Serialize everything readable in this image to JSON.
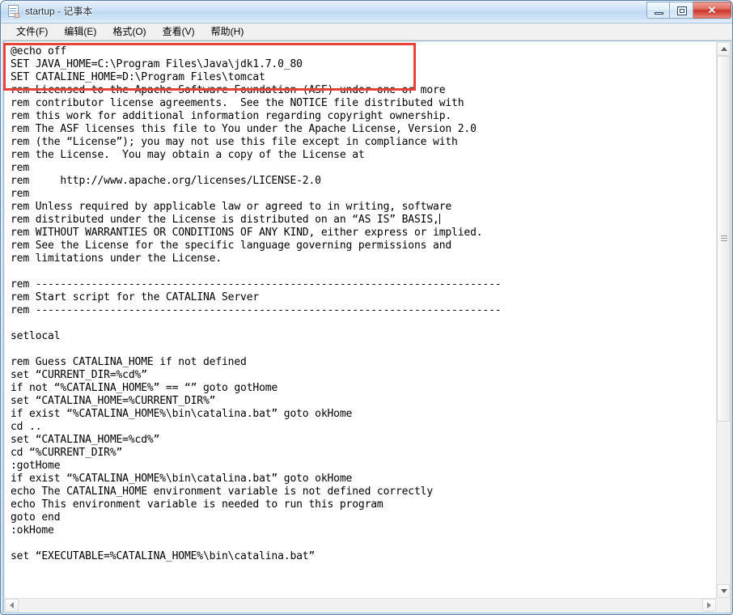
{
  "window": {
    "title": "startup - 记事本",
    "icon": "notepad-icon",
    "caption_buttons": [
      {
        "name": "minimize",
        "glyph": "—"
      },
      {
        "name": "maximize",
        "glyph": "□"
      },
      {
        "name": "close",
        "glyph": "✕"
      }
    ]
  },
  "menubar": {
    "items": [
      {
        "label": "文件(F)"
      },
      {
        "label": "编辑(E)"
      },
      {
        "label": "格式(O)"
      },
      {
        "label": "查看(V)"
      },
      {
        "label": "帮助(H)"
      }
    ]
  },
  "editor": {
    "highlighted_lines": "@echo off\nSET JAVA_HOME=C:\\Program Files\\Java\\jdk1.7.0_80\nSET CATALINE_HOME=D:\\Program Files\\tomcat",
    "body_before_caret": "\nrem Licensed to the Apache Software Foundation (ASF) under one or more\nrem contributor license agreements.  See the NOTICE file distributed with\nrem this work for additional information regarding copyright ownership.\nrem The ASF licenses this file to You under the Apache License, Version 2.0\nrem (the “License”); you may not use this file except in compliance with\nrem the License.  You may obtain a copy of the License at\nrem\nrem     http://www.apache.org/licenses/LICENSE-2.0\nrem\nrem Unless required by applicable law or agreed to in writing, software\nrem distributed under the License is distributed on an “AS IS” BASIS,",
    "body_after_caret": "\nrem WITHOUT WARRANTIES OR CONDITIONS OF ANY KIND, either express or implied.\nrem See the License for the specific language governing permissions and\nrem limitations under the License.\n\nrem ---------------------------------------------------------------------------\nrem Start script for the CATALINA Server\nrem ---------------------------------------------------------------------------\n\nsetlocal\n\nrem Guess CATALINA_HOME if not defined\nset “CURRENT_DIR=%cd%”\nif not “%CATALINA_HOME%” == “” goto gotHome\nset “CATALINA_HOME=%CURRENT_DIR%”\nif exist “%CATALINA_HOME%\\bin\\catalina.bat” goto okHome\ncd ..\nset “CATALINA_HOME=%cd%”\ncd “%CURRENT_DIR%”\n:gotHome\nif exist “%CATALINA_HOME%\\bin\\catalina.bat” goto okHome\necho The CATALINA_HOME environment variable is not defined correctly\necho This environment variable is needed to run this program\ngoto end\n:okHome\n\nset “EXECUTABLE=%CATALINA_HOME%\\bin\\catalina.bat”"
  },
  "annotation": {
    "red_box_color": "#e8413a"
  },
  "scrollbars": {
    "vertical": {
      "up_arrow": "▲",
      "down_arrow": "▼"
    },
    "horizontal": {
      "left_arrow": "◄",
      "right_arrow": "►"
    }
  }
}
